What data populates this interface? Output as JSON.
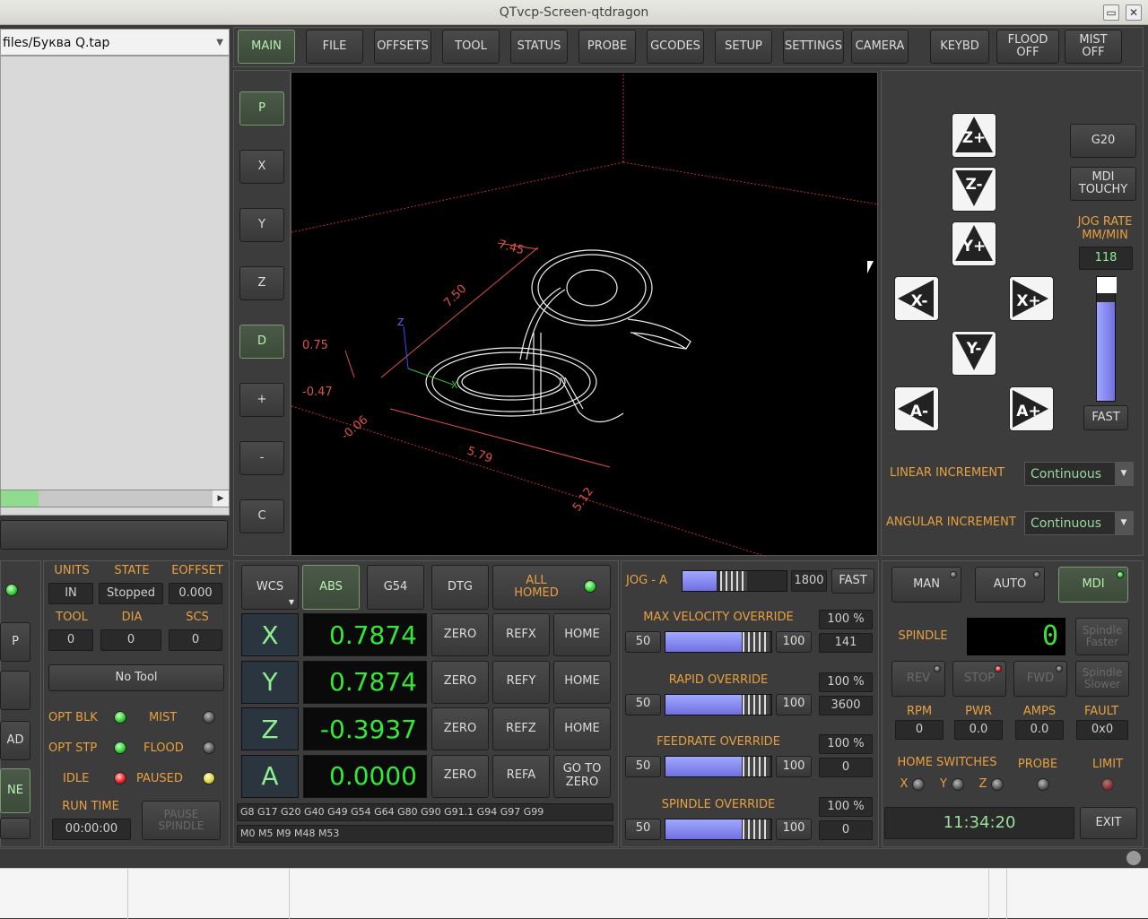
{
  "window": {
    "title": "QTvcp-Screen-qtdragon",
    "minimize": "▭",
    "close": "✕"
  },
  "file": {
    "path": "files/Буква Q.tap"
  },
  "tabs": [
    "MAIN",
    "FILE",
    "OFFSETS",
    "TOOL",
    "STATUS",
    "PROBE",
    "GCODES",
    "SETUP",
    "SETTINGS",
    "CAMERA"
  ],
  "tab_active": "MAIN",
  "top_buttons": {
    "keybd": "KEYBD",
    "flood": "FLOOD\nOFF",
    "mist": "MIST\nOFF"
  },
  "view_buttons": [
    "P",
    "X",
    "Y",
    "Z",
    "D",
    "+",
    "-",
    "C"
  ],
  "plot": {
    "dims": [
      "7.45",
      "7.50",
      "0.75",
      "-0.47",
      "-0.06",
      "5.79",
      "5.12"
    ],
    "axis_labels": [
      "Z",
      "X"
    ]
  },
  "jog": {
    "z_plus": "Z+",
    "z_minus": "Z-",
    "y_plus": "Y+",
    "y_minus": "Y-",
    "x_plus": "X+",
    "x_minus": "X-",
    "a_plus": "A+",
    "a_minus": "A-",
    "g20": "G20",
    "mdi_touchy": "MDI\nTOUCHY",
    "jog_rate_label": "JOG RATE\nMM/MIN",
    "jog_rate_value": "118",
    "jog_rate_level": 0.8,
    "fast": "FAST"
  },
  "increments": {
    "linear_label": "LINEAR INCREMENT",
    "linear_value": "Continuous",
    "angular_label": "ANGULAR INCREMENT",
    "angular_value": "Continuous"
  },
  "left_partial": {
    "b1": "P",
    "b2": "AD",
    "b3": "NE"
  },
  "status": {
    "units_label": "UNITS",
    "units": "IN",
    "state_label": "STATE",
    "state": "Stopped",
    "eoffset_label": "EOFFSET",
    "eoffset": "0.000",
    "tool_label": "TOOL",
    "tool": "0",
    "dia_label": "DIA",
    "dia": "0",
    "scs_label": "SCS",
    "scs": "0",
    "tool_name": "No Tool",
    "opt_blk": "OPT BLK",
    "mist": "MIST",
    "opt_stp": "OPT STP",
    "flood": "FLOOD",
    "idle": "IDLE",
    "paused": "PAUSED",
    "run_time_label": "RUN TIME",
    "run_time": "00:00:00",
    "pause_spindle": "PAUSE\nSPINDLE"
  },
  "dro": {
    "wcs": "WCS",
    "abs": "ABS",
    "g54": "G54",
    "dtg": "DTG",
    "all_homed": "ALL\nHOMED",
    "axes": [
      {
        "axis": "X",
        "value": "0.7874",
        "zero": "ZERO",
        "ref": "REFX",
        "home": "HOME"
      },
      {
        "axis": "Y",
        "value": "0.7874",
        "zero": "ZERO",
        "ref": "REFY",
        "home": "HOME"
      },
      {
        "axis": "Z",
        "value": "-0.3937",
        "zero": "ZERO",
        "ref": "REFZ",
        "home": "HOME"
      },
      {
        "axis": "A",
        "value": "0.0000",
        "zero": "ZERO",
        "ref": "REFA",
        "home": "GO TO\nZERO"
      }
    ],
    "gcodes": "G8 G17 G20 G40 G49 G54 G64 G80 G90 G91.1 G94 G97 G99",
    "mcodes": "M0 M5 M9 M48 M53"
  },
  "overrides": {
    "jog_a_label": "JOG - A",
    "jog_a_value": "1800",
    "jog_a_fast": "FAST",
    "jog_a_level": 0.33,
    "items": [
      {
        "label": "MAX VELOCITY OVERRIDE",
        "min": "50",
        "max": "100",
        "pct": "100 %",
        "val": "141",
        "level": 1.0
      },
      {
        "label": "RAPID OVERRIDE",
        "min": "50",
        "max": "100",
        "pct": "100 %",
        "val": "3600",
        "level": 1.0
      },
      {
        "label": "FEEDRATE OVERRIDE",
        "min": "50",
        "max": "100",
        "pct": "100 %",
        "val": "0",
        "level": 1.0
      },
      {
        "label": "SPINDLE OVERRIDE",
        "min": "50",
        "max": "100",
        "pct": "100 %",
        "val": "0",
        "level": 1.0
      }
    ]
  },
  "mode": {
    "man": "MAN",
    "auto": "AUTO",
    "mdi": "MDI"
  },
  "spindle": {
    "label": "SPINDLE",
    "value": "0",
    "faster": "Spindle\nFaster",
    "slower": "Spindle\nSlower",
    "rev": "REV",
    "stop": "STOP",
    "fwd": "FWD",
    "rpm_label": "RPM",
    "rpm": "0",
    "pwr_label": "PWR",
    "pwr": "0.0",
    "amps_label": "AMPS",
    "amps": "0.0",
    "fault_label": "FAULT",
    "fault": "0x0",
    "home_switches": "HOME SWITCHES",
    "probe": "PROBE",
    "limit": "LIMIT",
    "hx": "X",
    "hy": "Y",
    "hz": "Z"
  },
  "clock": {
    "time": "11:34:20",
    "exit": "EXIT"
  },
  "colors": {
    "accent": "#e8a040",
    "dro": "#35e835",
    "plot_bg": "#000000"
  }
}
